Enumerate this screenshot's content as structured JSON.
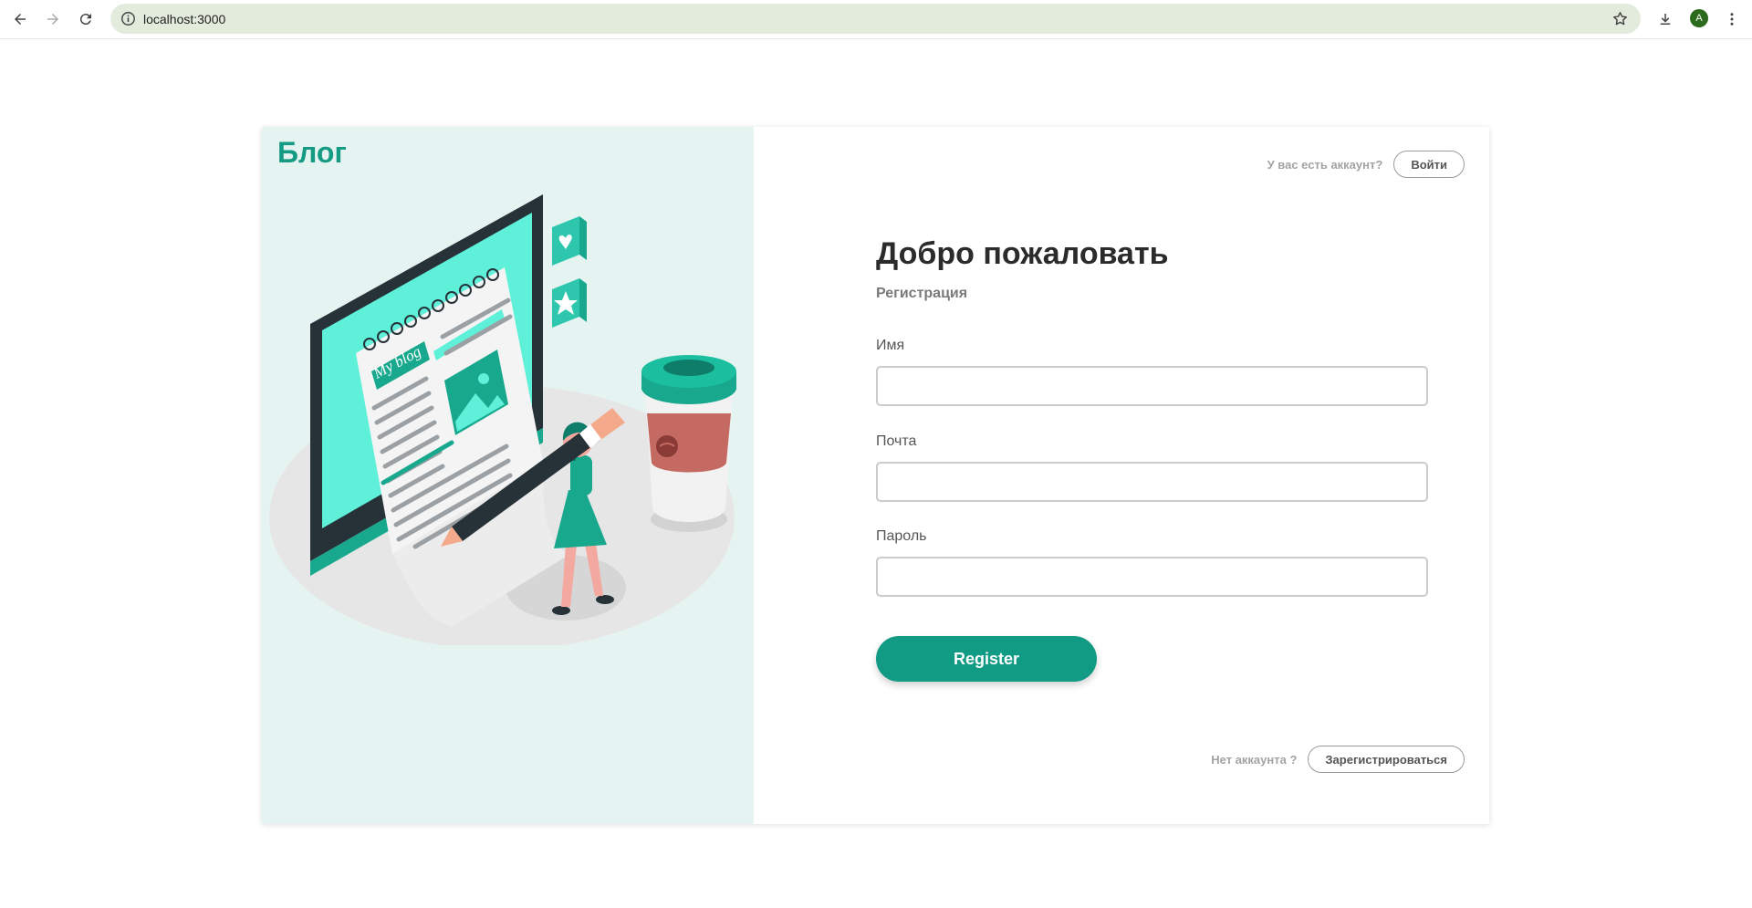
{
  "browser": {
    "url": "localhost:3000",
    "profile_initial": "A",
    "icons": [
      "back-icon",
      "forward-icon",
      "reload-icon",
      "site-info-icon",
      "bookmark-star-icon",
      "download-icon",
      "avatar",
      "menu-kebab-icon"
    ]
  },
  "brand": {
    "title": "Блог"
  },
  "illustration": {
    "blog_text": "My blog"
  },
  "header": {
    "has_account_text": "У вас есть аккаунт?",
    "login_label": "Войти"
  },
  "form": {
    "title": "Добро пожаловать",
    "subtitle": "Регистрация",
    "fields": [
      {
        "label": "Имя",
        "value": ""
      },
      {
        "label": "Почта",
        "value": ""
      },
      {
        "label": "Пароль",
        "value": ""
      }
    ],
    "submit_label": "Register"
  },
  "footer": {
    "no_account_text": "Нет аккаунта ?",
    "signup_label": "Зарегистрироваться"
  },
  "colors": {
    "accent": "#119a84",
    "left_panel_bg": "#e5f4f1",
    "omnibox_bg": "#e3ebdd"
  }
}
